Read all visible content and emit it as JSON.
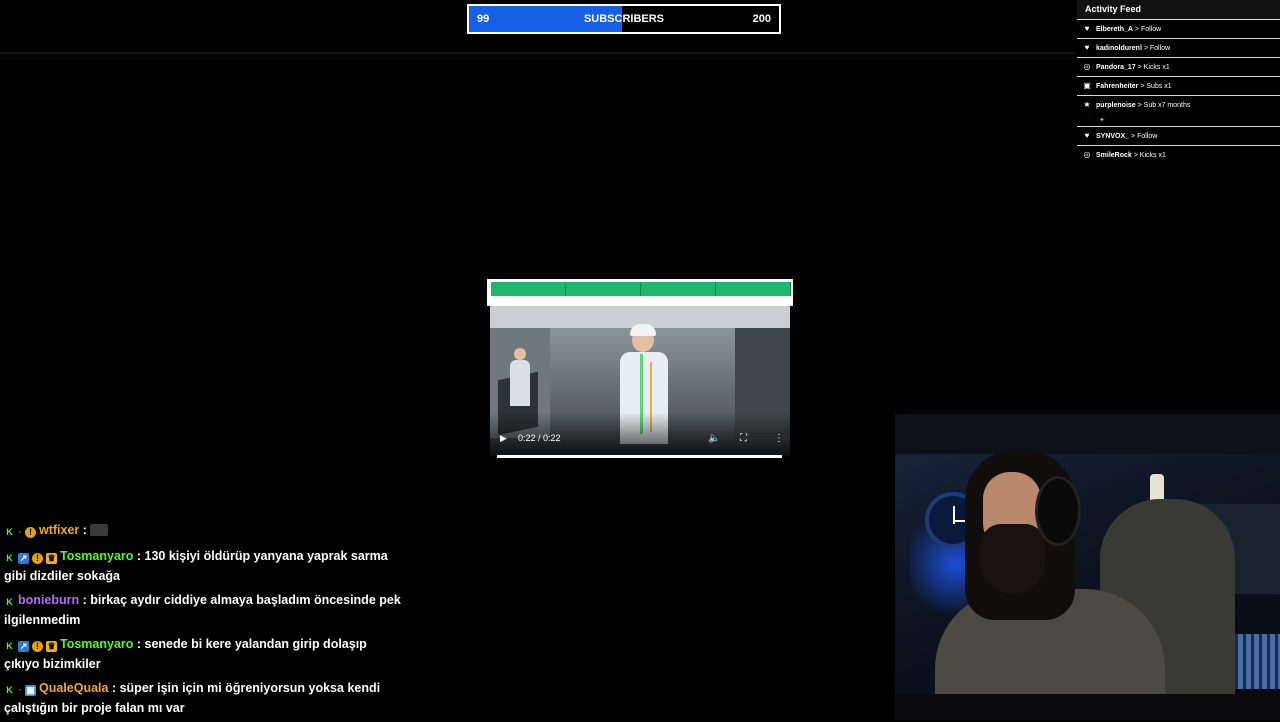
{
  "goal": {
    "current": "99",
    "label": "SUBSCRIBERS",
    "target": "200",
    "progress_fraction": 0.495,
    "fill_color": "#1660e6"
  },
  "activity_feed": {
    "title": "Activity Feed",
    "items": [
      {
        "icon": "heart-icon",
        "glyph": "♥",
        "name": "Elbereth_A",
        "action": "> Follow"
      },
      {
        "icon": "heart-icon",
        "glyph": "♥",
        "name": "kadinoldurenl",
        "action": "> Follow"
      },
      {
        "icon": "kick-icon",
        "glyph": "◎",
        "name": "Pandora_17",
        "action": "> Kicks x1"
      },
      {
        "icon": "gift-icon",
        "glyph": "▣",
        "name": "Fahrenheiter",
        "action": "> Subs x1"
      },
      {
        "icon": "star-icon",
        "glyph": "★",
        "name": "purplenoise",
        "action": "> Sub x7 months"
      },
      {
        "icon": "heart-icon",
        "glyph": "♥",
        "name": "SYNVOX_",
        "action": "> Follow"
      },
      {
        "icon": "kick-icon",
        "glyph": "◎",
        "name": "SmileRock",
        "action": "> Kicks x1"
      }
    ]
  },
  "player": {
    "time": "0:22 / 0:22",
    "progress_fraction": 1.0,
    "banner_tabs": [
      "",
      "",
      "",
      ""
    ]
  },
  "chat": [
    {
      "user": "wtfixer",
      "user_color": "#f5a623",
      "text": "",
      "badges": [
        "kick",
        "dot",
        "gold"
      ],
      "emote": true
    },
    {
      "user": "Tosmanyaro",
      "user_color": "#53fc18",
      "text": "130 kişiyi öldürüp yanyana yaprak sarma gibi dizdiler sokağa",
      "badges": [
        "kick",
        "blue",
        "gold",
        "crown"
      ],
      "emote": false
    },
    {
      "user": "bonieburn",
      "user_color": "#b26bff",
      "text": "birkaç aydır ciddiye almaya başladım öncesinde pek ilgilenmedim",
      "badges": [
        "kick"
      ],
      "emote": false
    },
    {
      "user": "Tosmanyaro",
      "user_color": "#53fc18",
      "text": "senede bi kere yalandan girip dolaşıp çıkıyo bizimkiler",
      "badges": [
        "kick",
        "blue",
        "gold",
        "crown"
      ],
      "emote": false
    },
    {
      "user": "QualeQuala",
      "user_color": "#f5a623",
      "text": "süper işin için mi öğreniyorsun yoksa kendi çalıştığın bir proje falan mı var",
      "badges": [
        "kick",
        "dot",
        "gift"
      ],
      "emote": false
    }
  ]
}
